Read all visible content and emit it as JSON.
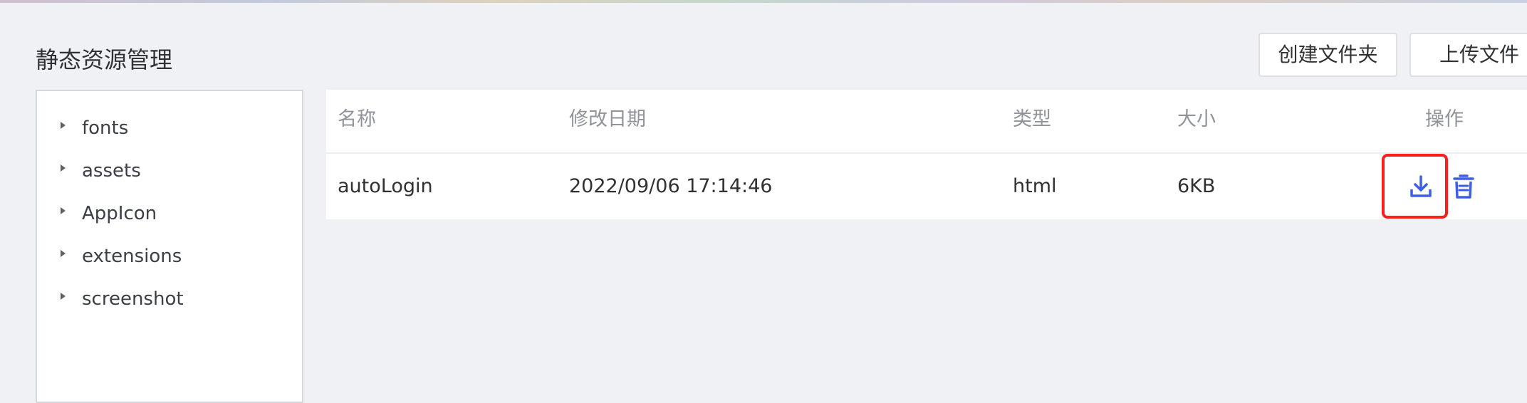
{
  "page": {
    "title": "静态资源管理"
  },
  "toolbar": {
    "create_folder_label": "创建文件夹",
    "upload_label": "上传文件"
  },
  "tree": {
    "items": [
      {
        "label": "fonts"
      },
      {
        "label": "assets"
      },
      {
        "label": "AppIcon"
      },
      {
        "label": "extensions"
      },
      {
        "label": "screenshot"
      }
    ]
  },
  "table": {
    "headers": {
      "name": "名称",
      "modified": "修改日期",
      "type": "类型",
      "size": "大小",
      "actions": "操作"
    },
    "rows": [
      {
        "name": "autoLogin",
        "modified": "2022/09/06 17:14:46",
        "type": "html",
        "size": "6KB"
      }
    ]
  },
  "icons": {
    "download": "download-icon",
    "delete": "trash-icon"
  },
  "colors": {
    "accent": "#3f5ee8",
    "highlight": "#ff1e1e",
    "background": "#f0f1f5"
  }
}
